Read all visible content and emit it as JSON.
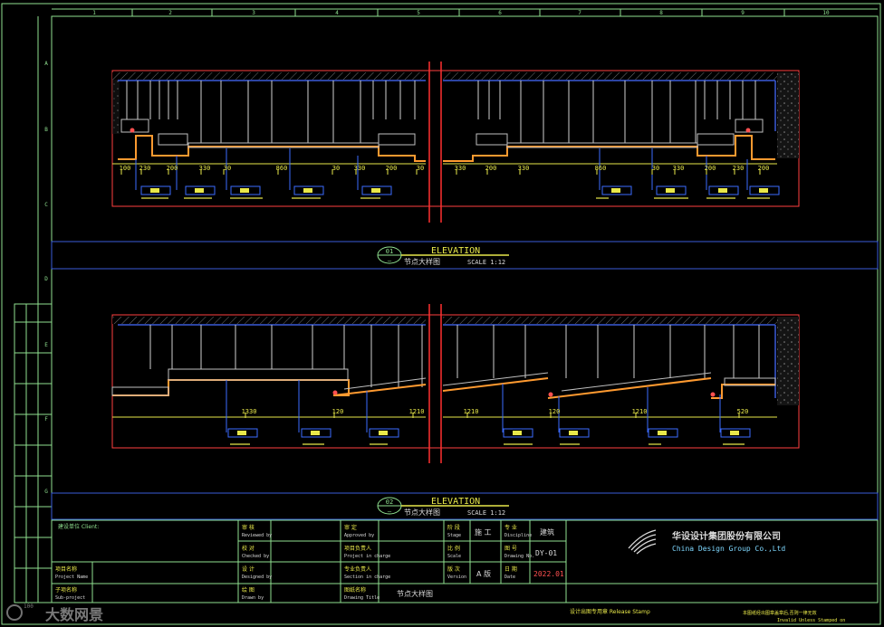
{
  "grid": {
    "columns": [
      "1",
      "2",
      "3",
      "4",
      "5",
      "6",
      "7",
      "8",
      "9",
      "10"
    ],
    "rows": [
      "A",
      "B",
      "C",
      "D",
      "E",
      "F",
      "G"
    ]
  },
  "elevation1": {
    "number": "01",
    "title": "ELEVATION",
    "subtitle": "节点大样图",
    "scale": "SCALE 1:12",
    "dimensions_left": [
      "100",
      "230",
      "200",
      "330",
      "30",
      "860",
      "30",
      "330",
      "200",
      "30"
    ],
    "dimensions_right": [
      "330",
      "200",
      "330",
      "860",
      "30",
      "330",
      "200",
      "230",
      "200"
    ]
  },
  "elevation2": {
    "number": "02",
    "title": "ELEVATION",
    "subtitle": "节点大样图",
    "scale": "SCALE 1:12",
    "dimensions": [
      "1330",
      "120",
      "1210",
      "1210",
      "120",
      "1210",
      "520"
    ]
  },
  "title_block": {
    "client_label": "建设单位 Client:",
    "project_name_label": "项目名称",
    "project_name_en": "Project Name",
    "subproject_label": "子项名称",
    "subproject_en": "Sub-project",
    "approved_label": "审 核",
    "approved_en": "Reviewed by",
    "checked_label": "校 对",
    "checked_en": "Checked by",
    "designed_label": "设 计",
    "designed_en": "Designed by",
    "drawn_label": "绘 图",
    "drawn_en": "Drawn by",
    "approver_label": "审 定",
    "approver_en": "Approved by",
    "pm_label": "项目负责人",
    "pm_en": "Project in charge",
    "discipline_head_label": "专业负责人",
    "discipline_head_en": "Section in charge",
    "drawing_title_label": "图纸名称",
    "drawing_title_en": "Drawing Title",
    "drawing_title": "节点大样图",
    "stage_label": "阶 段",
    "stage_en": "Stage",
    "stage": "施 工",
    "scale_label": "比 例",
    "scale_en": "Scale",
    "version_label": "版 次",
    "version_en": "Version",
    "version": "A 版",
    "discipline_label": "专 业",
    "discipline_en": "Discipline",
    "discipline": "建筑",
    "drawing_no_label": "图 号",
    "drawing_no_en": "Drawing No.",
    "drawing_no": "DY-01",
    "date_label": "日 期",
    "date_en": "Date",
    "date": "2022.01",
    "stamp_label": "设计出图专用章 Release Stamp",
    "company_cn": "华设设计集团股份有限公司",
    "company_en": "China Design Group Co.,Ltd",
    "footer_note_cn": "本图纸经出图章盖章后,否则一律无效",
    "footer_note_en": "Invalid Unless Stamped on"
  },
  "watermark": "大数网景",
  "colors": {
    "frame": "#8fe08f",
    "annotation": "#e8e84a",
    "section": "#ff4040",
    "finish": "#ff9a30",
    "hatch": "#7a7a7a",
    "hanger": "#cfcfcf",
    "blue": "#3a5bd8",
    "leader": "#3b6bff",
    "date_red": "#ff4040"
  }
}
